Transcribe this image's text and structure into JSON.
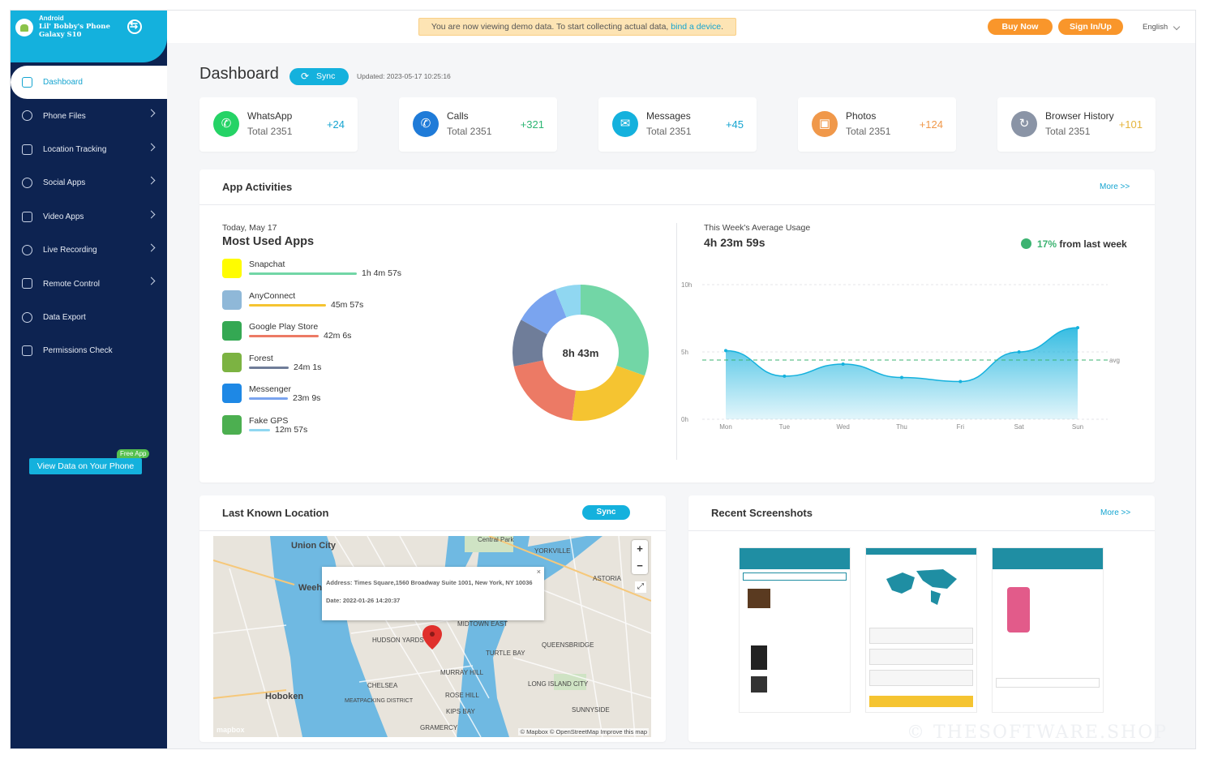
{
  "device": {
    "os": "Android",
    "name": "Lil' Bobby's Phone",
    "model": "Galaxy S10"
  },
  "nav": [
    {
      "label": "Dashboard",
      "icon": "dashboard-icon",
      "active": true
    },
    {
      "label": "Phone Files",
      "icon": "file-icon"
    },
    {
      "label": "Location Tracking",
      "icon": "location-icon"
    },
    {
      "label": "Social Apps",
      "icon": "chat-icon"
    },
    {
      "label": "Video Apps",
      "icon": "video-icon"
    },
    {
      "label": "Live Recording",
      "icon": "microphone-icon"
    },
    {
      "label": "Remote Control",
      "icon": "wifi-icon"
    },
    {
      "label": "Data Export",
      "icon": "export-icon"
    },
    {
      "label": "Permissions Check",
      "icon": "shield-icon"
    }
  ],
  "promo": {
    "label": "View Data on Your Phone",
    "badge": "Free App"
  },
  "banner": {
    "text": "You are now viewing demo data. To start collecting actual data, ",
    "link": "bind a device",
    "end": "."
  },
  "top": {
    "buy": "Buy Now",
    "sign": "Sign In/Up",
    "language": "English"
  },
  "header": {
    "title": "Dashboard",
    "sync": "Sync",
    "updated": "Updated: 2023-05-17 10:25:16"
  },
  "stats": [
    {
      "name": "WhatsApp",
      "total": "Total 2351",
      "change": "+24",
      "color": "#25d366",
      "change_color": "#14a4d0",
      "icon": "whatsapp-icon"
    },
    {
      "name": "Calls",
      "total": "Total 2351",
      "change": "+321",
      "color": "#1f7bd8",
      "change_color": "#2bb673",
      "icon": "phone-icon"
    },
    {
      "name": "Messages",
      "total": "Total 2351",
      "change": "+45",
      "color": "#14b1dd",
      "change_color": "#14a4d0",
      "icon": "message-icon"
    },
    {
      "name": "Photos",
      "total": "Total 2351",
      "change": "+124",
      "color": "#f0984a",
      "change_color": "#f0984a",
      "icon": "photo-icon"
    },
    {
      "name": "Browser History",
      "total": "Total 2351",
      "change": "+101",
      "color": "#8a94a6",
      "change_color": "#e5b43a",
      "icon": "history-icon"
    }
  ],
  "activities": {
    "title": "App Activities",
    "more": "More >>",
    "date": "Today, May 17",
    "heading": "Most Used Apps",
    "apps": [
      {
        "name": "Snapchat",
        "time": "1h 4m 57s",
        "color": "#72d6a6",
        "share": 0.246,
        "icon": "snapchat-icon"
      },
      {
        "name": "AnyConnect",
        "time": "45m 57s",
        "color": "#f5c431",
        "share": 0.175,
        "icon": "anyconnect-icon"
      },
      {
        "name": "Google Play Store",
        "time": "42m 6s",
        "color": "#ec7a65",
        "share": 0.16,
        "icon": "playstore-icon"
      },
      {
        "name": "Forest",
        "time": "24m 1s",
        "color": "#6f7d99",
        "share": 0.091,
        "icon": "forest-icon"
      },
      {
        "name": "Messenger",
        "time": "23m 9s",
        "color": "#7aa4ef",
        "share": 0.088,
        "icon": "messenger-icon"
      },
      {
        "name": "Fake GPS",
        "time": "12m 57s",
        "color": "#90d7f1",
        "share": 0.049,
        "icon": "fakegps-icon"
      }
    ],
    "total": "8h 43m",
    "week_label": "This Week's Average Usage",
    "week_value": "4h 23m 59s",
    "trend_pct": "17%",
    "trend_text": " from last week"
  },
  "chart_data": [
    {
      "type": "pie",
      "title": "Most Used Apps",
      "categories": [
        "Snapchat",
        "AnyConnect",
        "Google Play Store",
        "Forest",
        "Messenger",
        "Fake GPS"
      ],
      "values": [
        64.95,
        45.95,
        42.1,
        24.02,
        23.15,
        12.95
      ],
      "center_label": "8h 43m"
    },
    {
      "type": "area",
      "title": "This Week's Average Usage",
      "categories": [
        "Mon",
        "Tue",
        "Wed",
        "Thu",
        "Fri",
        "Sat",
        "Sun"
      ],
      "series": [
        {
          "values": [
            5.1,
            3.2,
            4.1,
            3.1,
            2.8,
            5.0,
            6.8
          ]
        }
      ],
      "avg": 4.4,
      "avg_label": "avg",
      "y_ticks": [
        "0h",
        "5h",
        "10h"
      ],
      "ylim": [
        0,
        10
      ]
    }
  ],
  "location": {
    "title": "Last Known Location",
    "sync": "Sync",
    "address": "Address: Times Square,1560 Broadway Suite 1001, New York, NY 10036",
    "date": "Date: 2022-01-26 14:20:37",
    "labels": [
      "Union City",
      "Hoboken",
      "Weeh",
      "MIDTOWN EAST",
      "CHELSEA",
      "QUEENSBRIDGE",
      "ASTORIA",
      "LONG ISLAND CITY",
      "MURRAY HILL",
      "TURTLE BAY",
      "Central Park",
      "YORKVILLE",
      "SUNNYSIDE",
      "ROSE HILL",
      "KIPS BAY",
      "HUDSON YARDS",
      "GRAMERCY",
      "MEATPACKING DISTRICT"
    ],
    "attribution": "© Mapbox © OpenStreetMap Improve this map",
    "logo": "mapbox"
  },
  "screenshots": {
    "title": "Recent Screenshots",
    "more": "More >>"
  },
  "watermark": "© THESOFTWARE.SHOP"
}
